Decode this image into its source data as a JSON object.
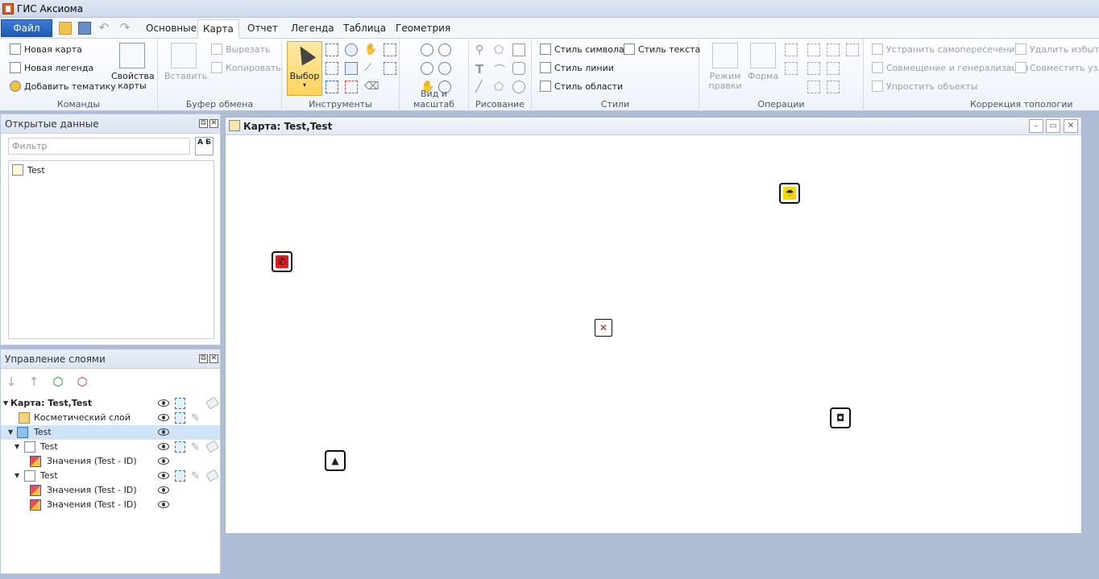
{
  "window": {
    "title": "ГИС Аксиома"
  },
  "menu": {
    "file_label": "Файл",
    "tabs": [
      "Основные",
      "Карта",
      "Отчет",
      "Легенда",
      "Таблица",
      "Геометрия"
    ],
    "active_tab": "Карта"
  },
  "ribbon": {
    "commands": {
      "label": "Команды",
      "new_map": "Новая карта",
      "new_legend": "Новая легенда",
      "add_theme": "Добавить тематику",
      "map_props": "Свойства карты"
    },
    "clipboard": {
      "label": "Буфер обмена",
      "paste": "Вставить",
      "cut": "Вырезать",
      "copy": "Копировать"
    },
    "tools": {
      "label": "Инструменты",
      "select": "Выбор"
    },
    "view": {
      "label": "Вид и масштаб"
    },
    "draw": {
      "label": "Рисование"
    },
    "styles": {
      "label": "Стили",
      "symbol_style": "Стиль символа",
      "text_style": "Стиль текста",
      "line_style": "Стиль линии",
      "area_style": "Стиль области"
    },
    "operations": {
      "label": "Операции",
      "edit_mode": "Режим правки",
      "shape": "Форма"
    },
    "topology": {
      "label": "Коррекция топологии",
      "fix_self_intersections": "Устранить самопересечения",
      "align_generalize": "Совмещение и генерализация",
      "simplify": "Упростить объекты",
      "remove_redundant": "Удалить избыто",
      "align_nodes": "Совместить узлы"
    }
  },
  "open_data": {
    "title": "Открытые данные",
    "filter_placeholder": "Фильтр",
    "sort_label": "А Б",
    "items": [
      "Test"
    ]
  },
  "layers": {
    "title": "Управление слоями",
    "rows": [
      {
        "label": "Карта: Test,Test"
      },
      {
        "label": "Косметический слой"
      },
      {
        "label": "Test"
      },
      {
        "label": "Test"
      },
      {
        "label": "Значения (Test - ID)"
      },
      {
        "label": "Test"
      },
      {
        "label": "Значения (Test - ID)"
      },
      {
        "label": "Значения (Test - ID)"
      }
    ]
  },
  "map": {
    "title": "Карта: Test,Test",
    "symbols": [
      {
        "name": "umbrella-sign-icon",
        "fill": "#f6d800",
        "glyph": "☂"
      },
      {
        "name": "pedestrian-sign-icon",
        "fill": "#e21b1b",
        "glyph": "✆"
      },
      {
        "name": "no-vehicle-sign-icon",
        "fill": "#ffffff",
        "glyph": "✕"
      },
      {
        "name": "square-sign-icon",
        "fill": "#ffffff",
        "glyph": "◘"
      },
      {
        "name": "triangle-sign-icon",
        "fill": "#ffffff",
        "glyph": "▲"
      }
    ]
  },
  "colors": {
    "accent": "#1f5bb5",
    "selected_row": "#cfe4f7",
    "background": "#aebcd6"
  }
}
